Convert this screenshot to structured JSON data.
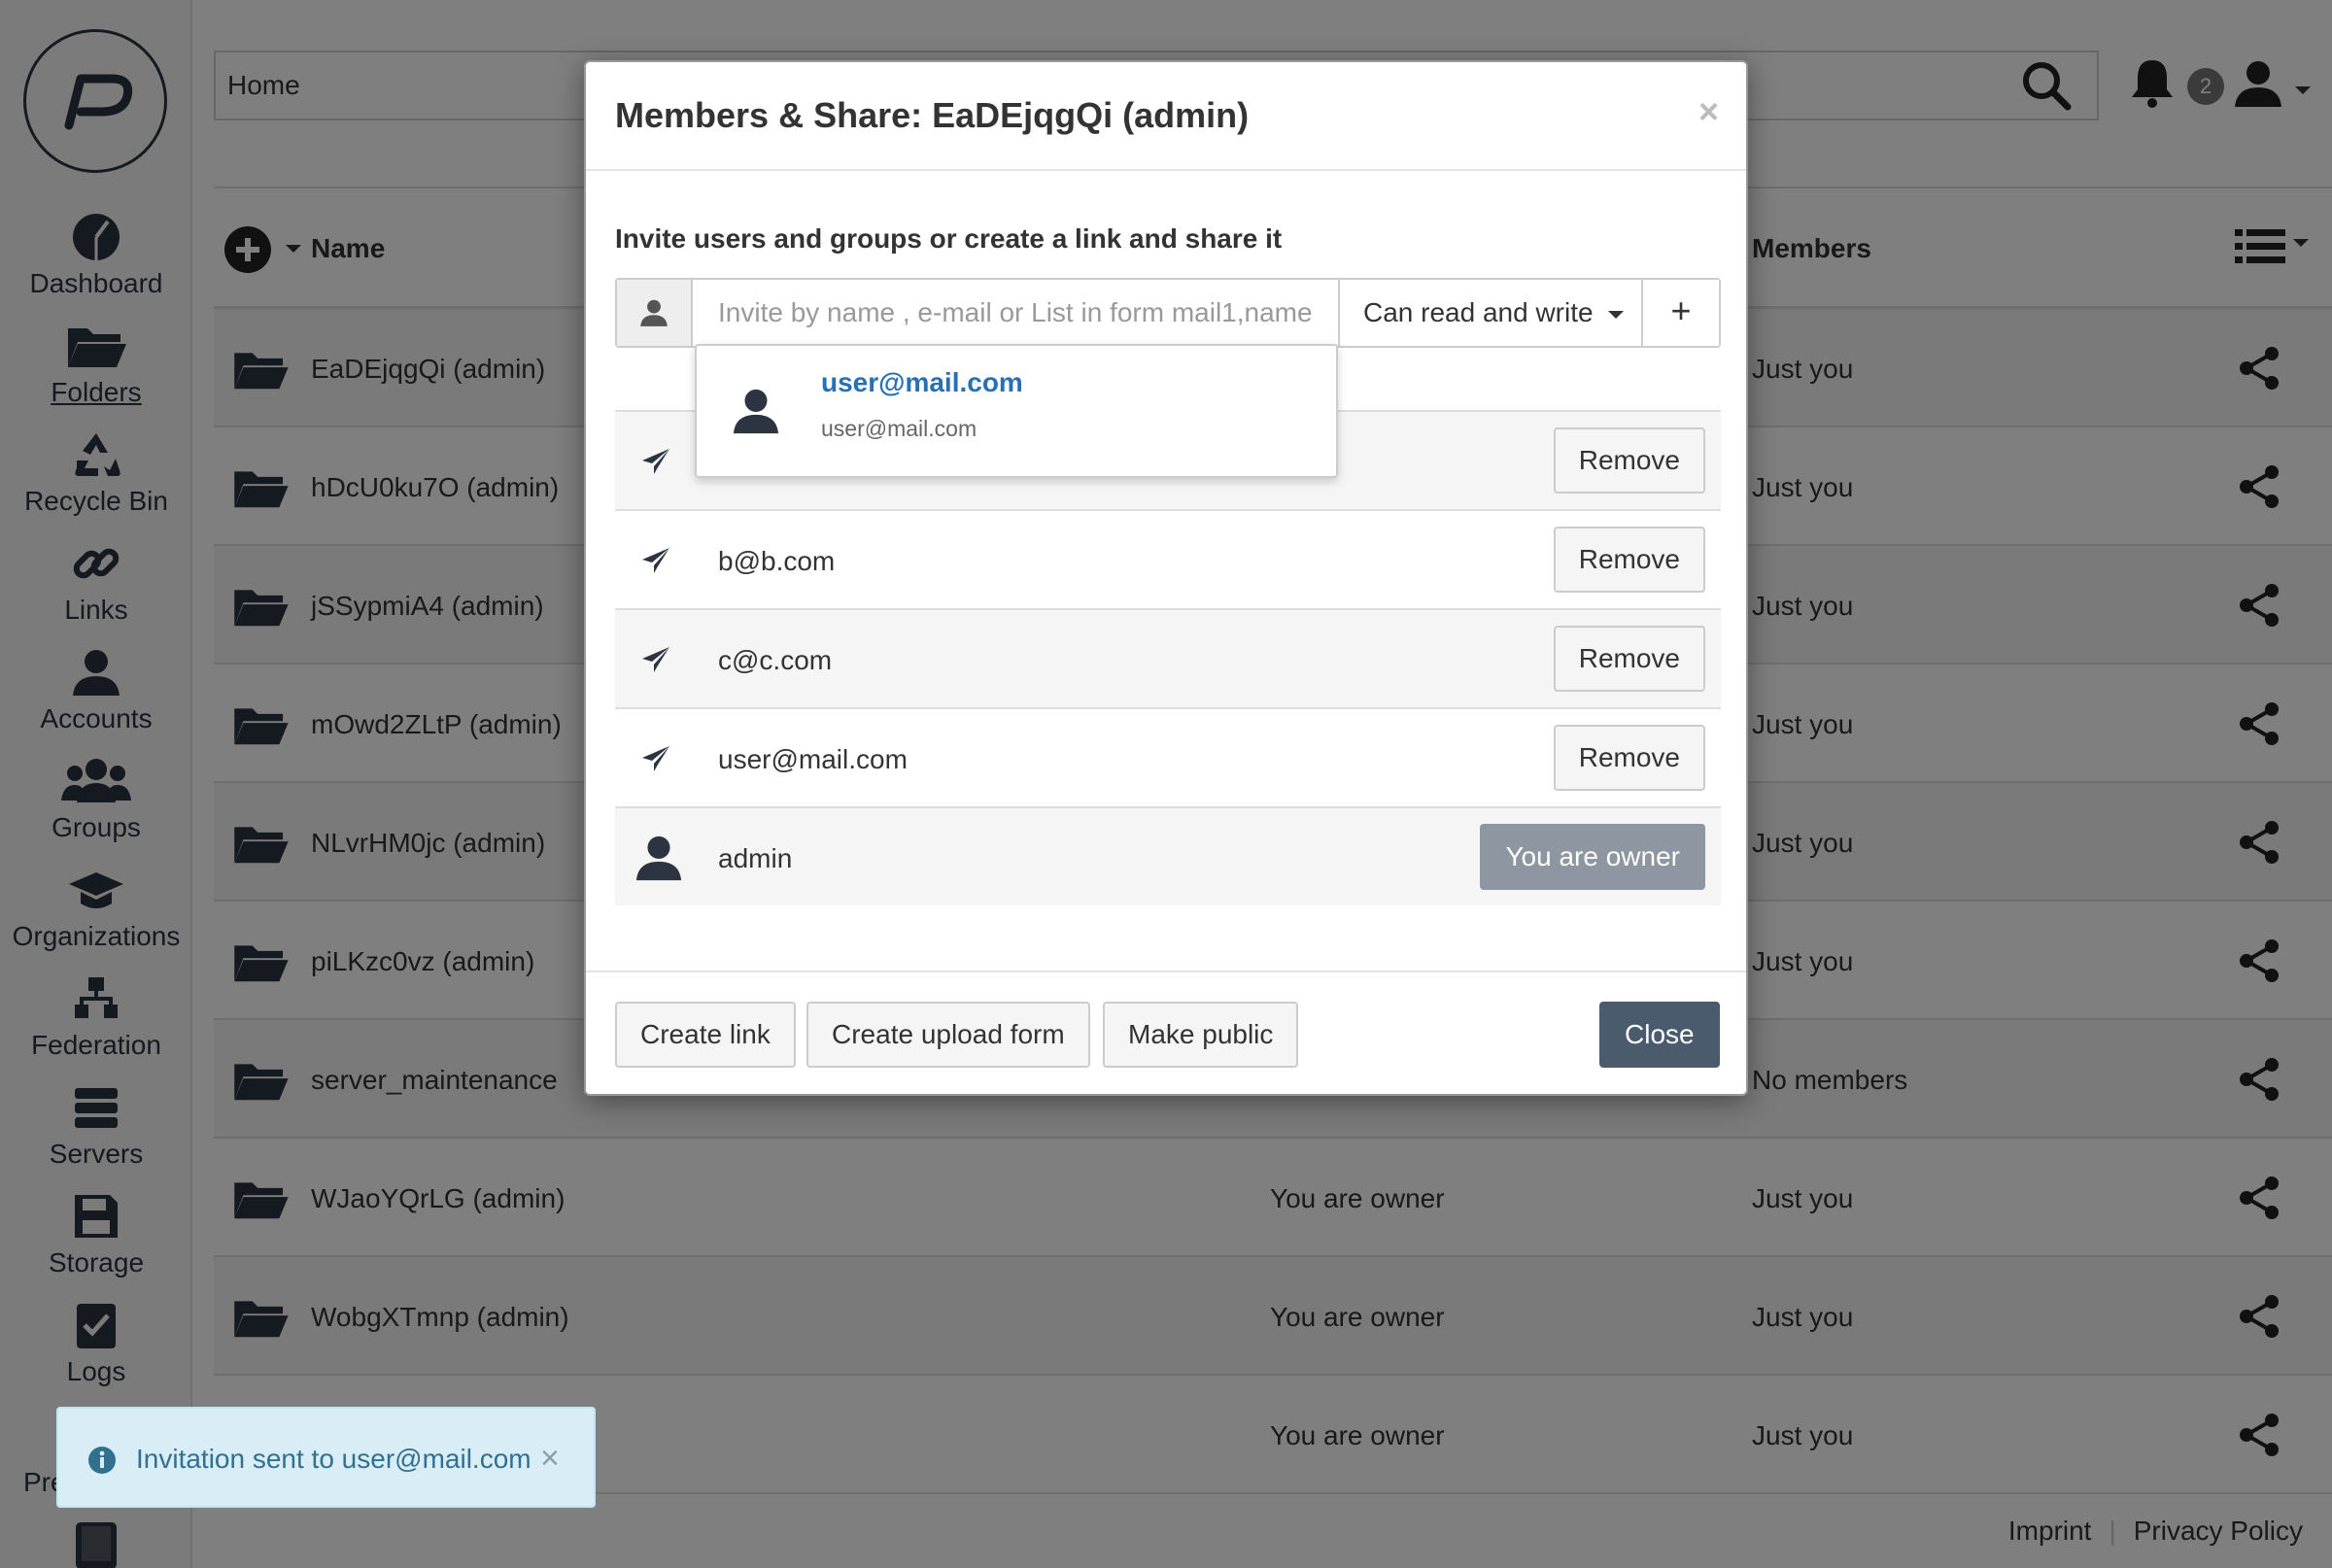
{
  "sidebar": {
    "logo_icon": "p-logo-icon",
    "items": [
      {
        "label": "Dashboard",
        "icon": "dashboard-icon"
      },
      {
        "label": "Folders",
        "icon": "folder-icon"
      },
      {
        "label": "Recycle Bin",
        "icon": "recycle-icon"
      },
      {
        "label": "Links",
        "icon": "link-icon"
      },
      {
        "label": "Accounts",
        "icon": "user-icon"
      },
      {
        "label": "Groups",
        "icon": "group-icon"
      },
      {
        "label": "Organizations",
        "icon": "graduation-cap-icon"
      },
      {
        "label": "Federation",
        "icon": "federation-icon"
      },
      {
        "label": "Servers",
        "icon": "servers-icon"
      },
      {
        "label": "Storage",
        "icon": "floppy-icon"
      },
      {
        "label": "Logs",
        "icon": "logs-icon"
      }
    ],
    "cut_label": "Pre"
  },
  "header": {
    "breadcrumb": "Home",
    "notification_count": "2"
  },
  "table": {
    "col_name": "Name",
    "col_members": "Members",
    "rows": [
      {
        "name": "EaDEjqgQi (admin)",
        "status": "",
        "members": "Just you"
      },
      {
        "name": "hDcU0ku7O (admin)",
        "status": "",
        "members": "Just you"
      },
      {
        "name": "jSSypmiA4 (admin)",
        "status": "",
        "members": "Just you"
      },
      {
        "name": "mOwd2ZLtP (admin)",
        "status": "",
        "members": "Just you"
      },
      {
        "name": "NLvrHM0jc (admin)",
        "status": "",
        "members": "Just you"
      },
      {
        "name": "piLKzc0vz (admin)",
        "status": "",
        "members": "Just you"
      },
      {
        "name": "server_maintenance",
        "status": "",
        "members": "No members"
      },
      {
        "name": "WJaoYQrLG (admin)",
        "status": "You are owner",
        "members": "Just you"
      },
      {
        "name": "WobgXTmnp (admin)",
        "status": "You are owner",
        "members": "Just you"
      },
      {
        "name": "",
        "status": "You are owner",
        "members": "Just you"
      }
    ]
  },
  "footer": {
    "imprint": "Imprint",
    "privacy": "Privacy Policy"
  },
  "modal": {
    "title": "Members & Share: EaDEjqgQi (admin)",
    "close_symbol": "×",
    "invite_label": "Invite users and groups or create a link and share it",
    "invite_placeholder": "Invite by name , e-mail or List in form mail1,name",
    "permission": "Can read and write",
    "add_symbol": "+",
    "members": [
      {
        "email": "",
        "action": "Remove"
      },
      {
        "email": "b@b.com",
        "action": "Remove"
      },
      {
        "email": "c@c.com",
        "action": "Remove"
      },
      {
        "email": "user@mail.com",
        "action": "Remove"
      }
    ],
    "owner": {
      "name": "admin",
      "label": "You are owner"
    },
    "autocomplete": {
      "title": "user@mail.com",
      "subtitle": "user@mail.com"
    },
    "buttons": {
      "create_link": "Create link",
      "create_upload_form": "Create upload form",
      "make_public": "Make public",
      "close": "Close"
    }
  },
  "toast": {
    "text": "Invitation sent to user@mail.com",
    "close_symbol": "×"
  },
  "colors": {
    "primary_dark": "#4b5b6e",
    "link_blue": "#2a6fb3",
    "toast_bg": "#d9edf7",
    "toast_text": "#31708f"
  }
}
